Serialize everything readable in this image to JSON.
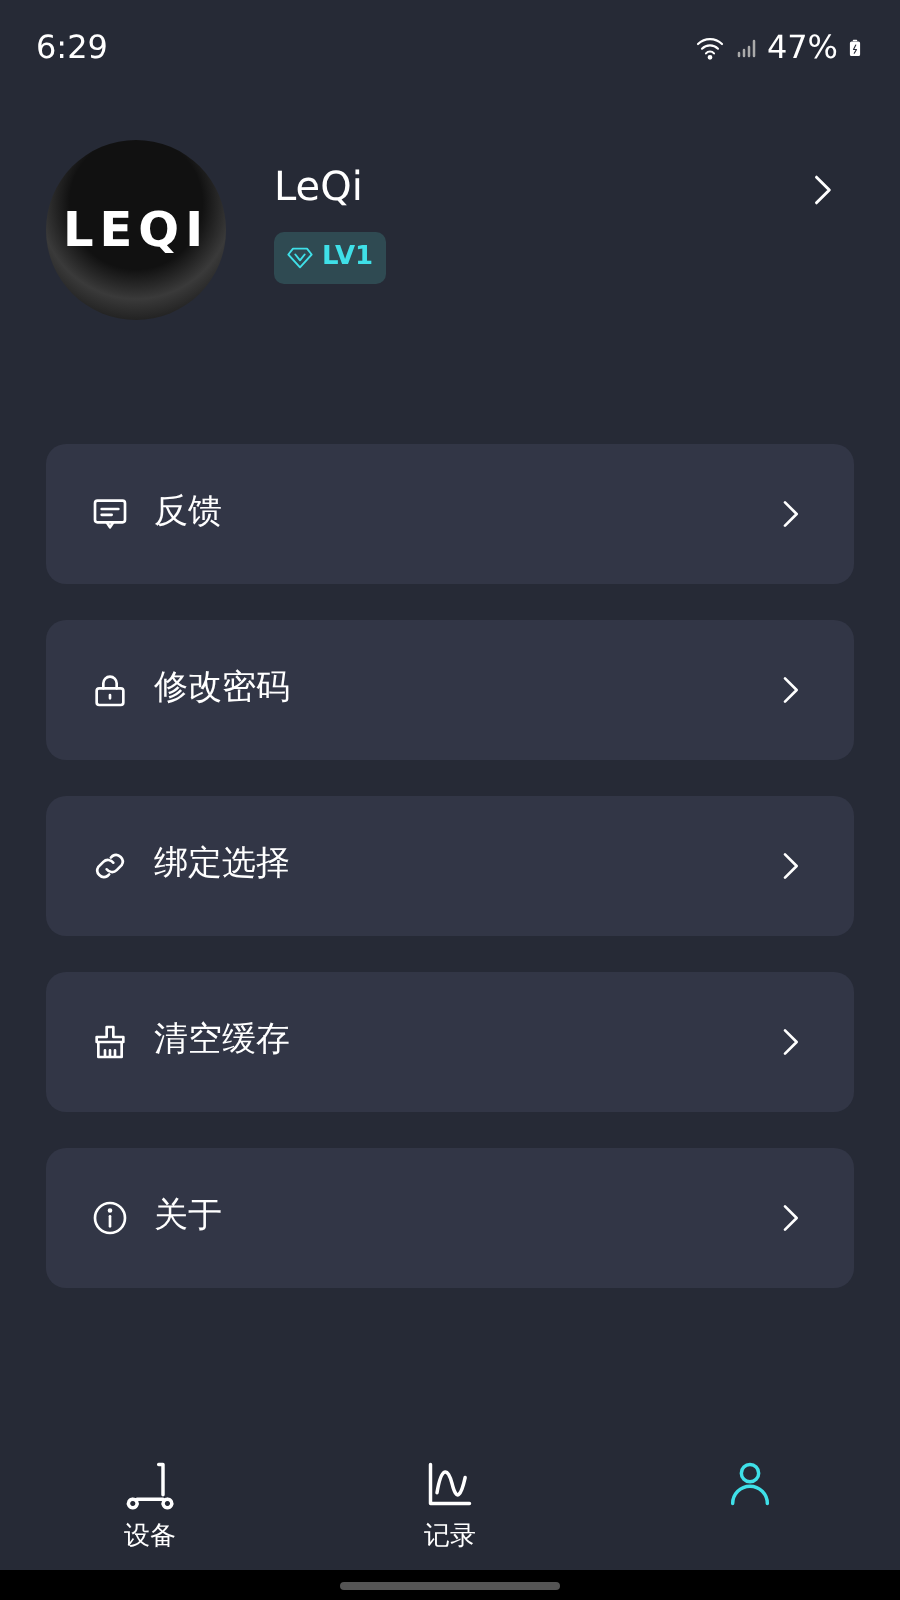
{
  "status_bar": {
    "time": "6:29",
    "battery": "47%"
  },
  "profile": {
    "name": "LeQi",
    "avatar_text": "LEQI",
    "level": "LV1"
  },
  "menu": [
    {
      "kind": "feedback",
      "label": "反馈"
    },
    {
      "kind": "lock",
      "label": "修改密码"
    },
    {
      "kind": "link",
      "label": "绑定选择"
    },
    {
      "kind": "broom",
      "label": "清空缓存"
    },
    {
      "kind": "info",
      "label": "关于"
    }
  ],
  "tabs": [
    {
      "kind": "scooter",
      "label": "设备",
      "selected": false
    },
    {
      "kind": "chart",
      "label": "记录",
      "selected": false
    },
    {
      "kind": "person",
      "selected": true
    }
  ]
}
